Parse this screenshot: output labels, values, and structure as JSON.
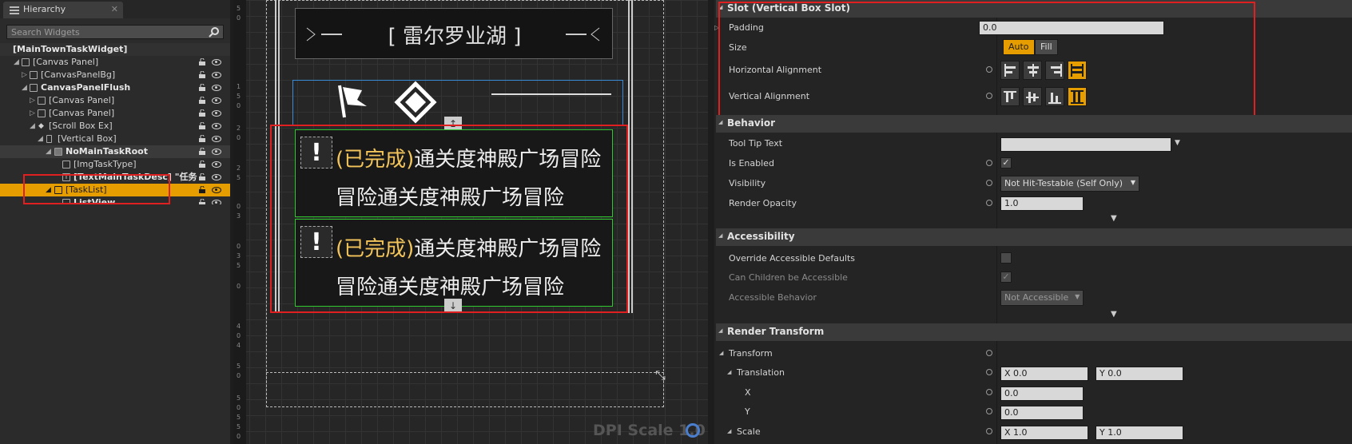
{
  "hierarchy": {
    "tab_label": "Hierarchy",
    "search_placeholder": "Search Widgets",
    "rows": [
      {
        "label": "[MainTownTaskWidget]"
      },
      {
        "label": "[Canvas Panel]"
      },
      {
        "label": "[CanvasPanelBg]"
      },
      {
        "label": "CanvasPanelFlush"
      },
      {
        "label": "[Canvas Panel]"
      },
      {
        "label": "[Canvas Panel]"
      },
      {
        "label": "[Scroll Box Ex]"
      },
      {
        "label": "[Vertical Box]"
      },
      {
        "label": "NoMainTaskRoot"
      },
      {
        "label": "[ImgTaskType]"
      },
      {
        "label": "[TextMainTaskDesc] \"任务"
      },
      {
        "label": "[TaskList]"
      },
      {
        "label": "ListView"
      }
    ]
  },
  "canvas": {
    "ruler_ticks": [
      "5",
      "0",
      "1",
      "5",
      "0",
      "2",
      "0",
      "2",
      "5",
      "0",
      "3",
      "0",
      "3",
      "5",
      "0",
      "4",
      "0",
      "4",
      "5",
      "0",
      "5",
      "0",
      "5",
      "5",
      "0"
    ],
    "title": "[ 雷尔罗业湖 ]",
    "tasks": [
      {
        "status": "(已完成)",
        "line1": "通关度神殿广场冒险",
        "line2": "冒险通关度神殿广场冒险"
      },
      {
        "status": "(已完成)",
        "line1": "通关度神殿广场冒险",
        "line2": "冒险通关度神殿广场冒险"
      }
    ],
    "dpi_label": "DPI Scale 1.0"
  },
  "details": {
    "slot_section": "Slot (Vertical Box Slot)",
    "padding_label": "Padding",
    "padding_value": "0.0",
    "size_label": "Size",
    "size_auto": "Auto",
    "size_fill": "Fill",
    "halign_label": "Horizontal Alignment",
    "valign_label": "Vertical Alignment",
    "behavior_section": "Behavior",
    "tooltip_label": "Tool Tip Text",
    "enabled_label": "Is Enabled",
    "visibility_label": "Visibility",
    "visibility_value": "Not Hit-Testable (Self Only)",
    "opacity_label": "Render Opacity",
    "opacity_value": "1.0",
    "accessibility_section": "Accessibility",
    "override_label": "Override Accessible Defaults",
    "children_label": "Can Children be Accessible",
    "behavior_label": "Accessible Behavior",
    "behavior_value": "Not Accessible",
    "render_section": "Render Transform",
    "transform_label": "Transform",
    "translation_label": "Translation",
    "x_label": "X",
    "y_label": "Y",
    "tx": "0.0",
    "ty": "0.0",
    "x_value": "0.0",
    "y_value": "0.0",
    "scale_label": "Scale",
    "sx": "1.0",
    "sy": "1.0"
  },
  "colors": {
    "accent": "#e69d00",
    "highlight_box": "#e02020",
    "selection_outline": "#2fc92f"
  }
}
